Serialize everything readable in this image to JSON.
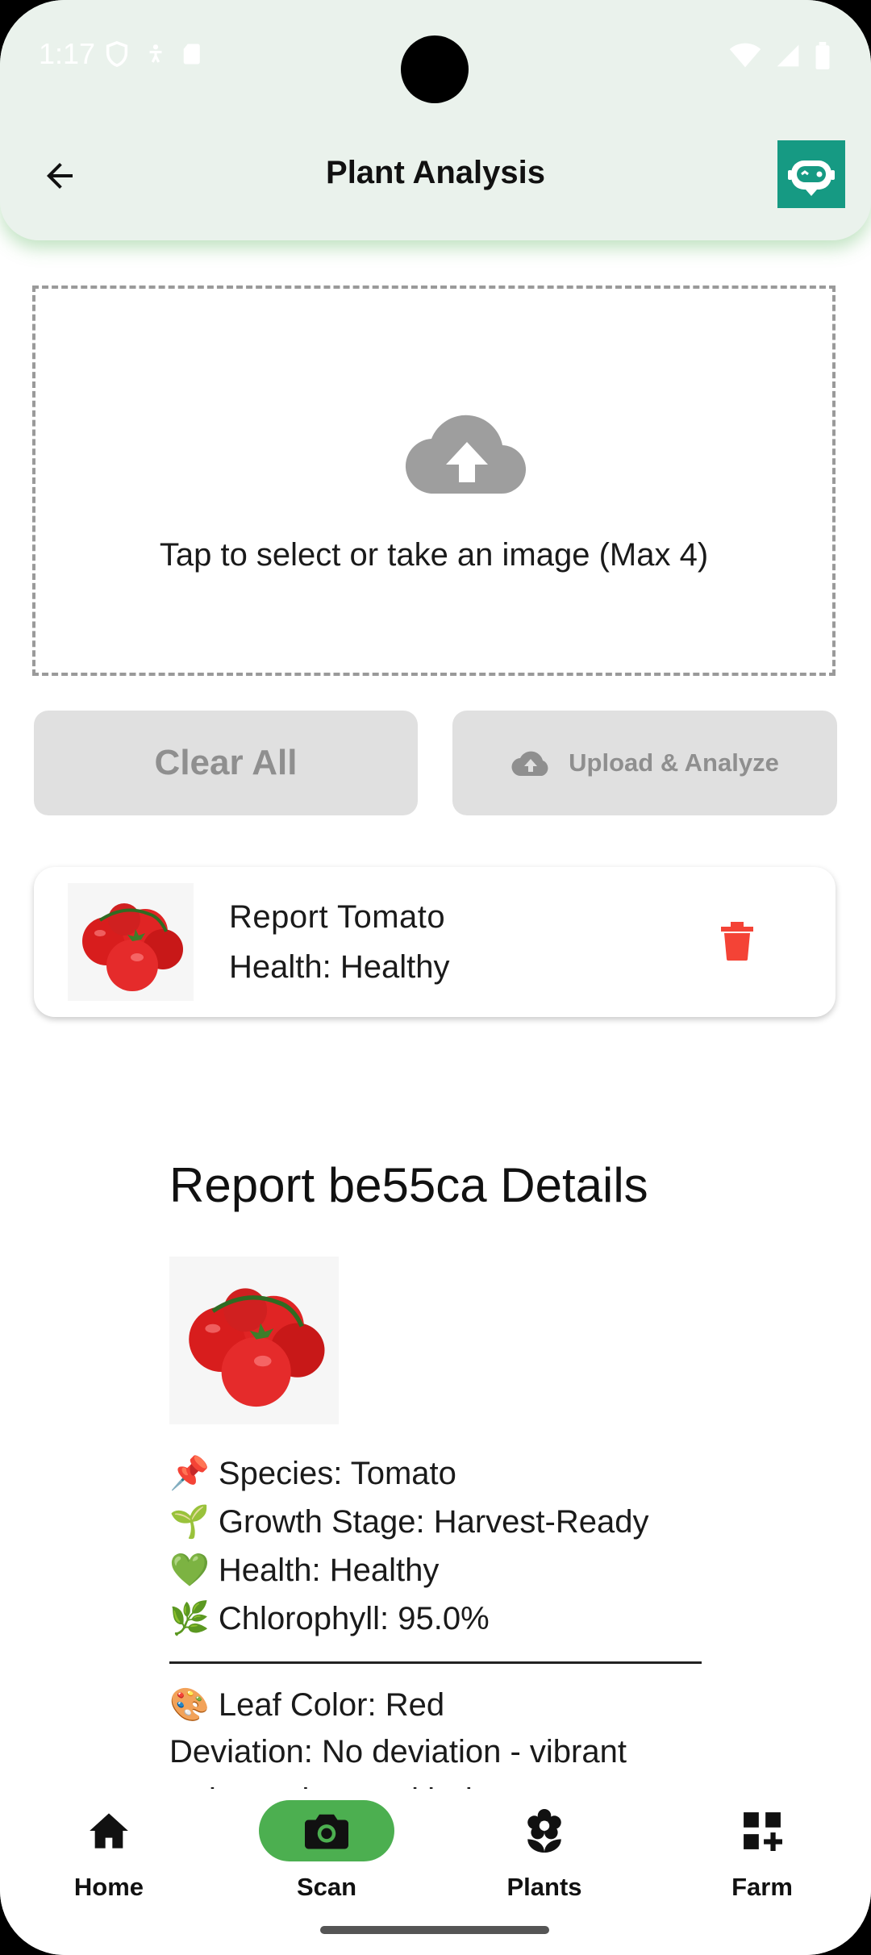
{
  "status_bar": {
    "time": "1:17"
  },
  "header": {
    "title": "Plant Analysis"
  },
  "upload": {
    "prompt": "Tap to select or take an image (Max 4)"
  },
  "actions": {
    "clear_label": "Clear All",
    "upload_label": "Upload & Analyze"
  },
  "report_card": {
    "title": "Report  Tomato",
    "health": "Health: Healthy"
  },
  "details": {
    "title": "Report be55ca Details",
    "species": "📌 Species: Tomato",
    "growth_stage": "🌱 Growth Stage: Harvest-Ready",
    "health": "💚 Health: Healthy",
    "chlorophyll": "🌿 Chlorophyll: 95.0%",
    "leaf_color": "🎨 Leaf Color: Red",
    "deviation": "Deviation: No deviation - vibrant",
    "deviation_cont": "red, consistent with ripeness"
  },
  "nav": {
    "items": [
      {
        "label": "Home",
        "icon": "home-icon"
      },
      {
        "label": "Scan",
        "icon": "camera-icon"
      },
      {
        "label": "Plants",
        "icon": "flower-icon"
      },
      {
        "label": "Farm",
        "icon": "grid-add-icon"
      }
    ],
    "active_index": 1
  },
  "colors": {
    "accent": "#4caf50",
    "bot_button": "#169a83",
    "delete": "#f44336",
    "header_bg": "#eaf2ec"
  }
}
